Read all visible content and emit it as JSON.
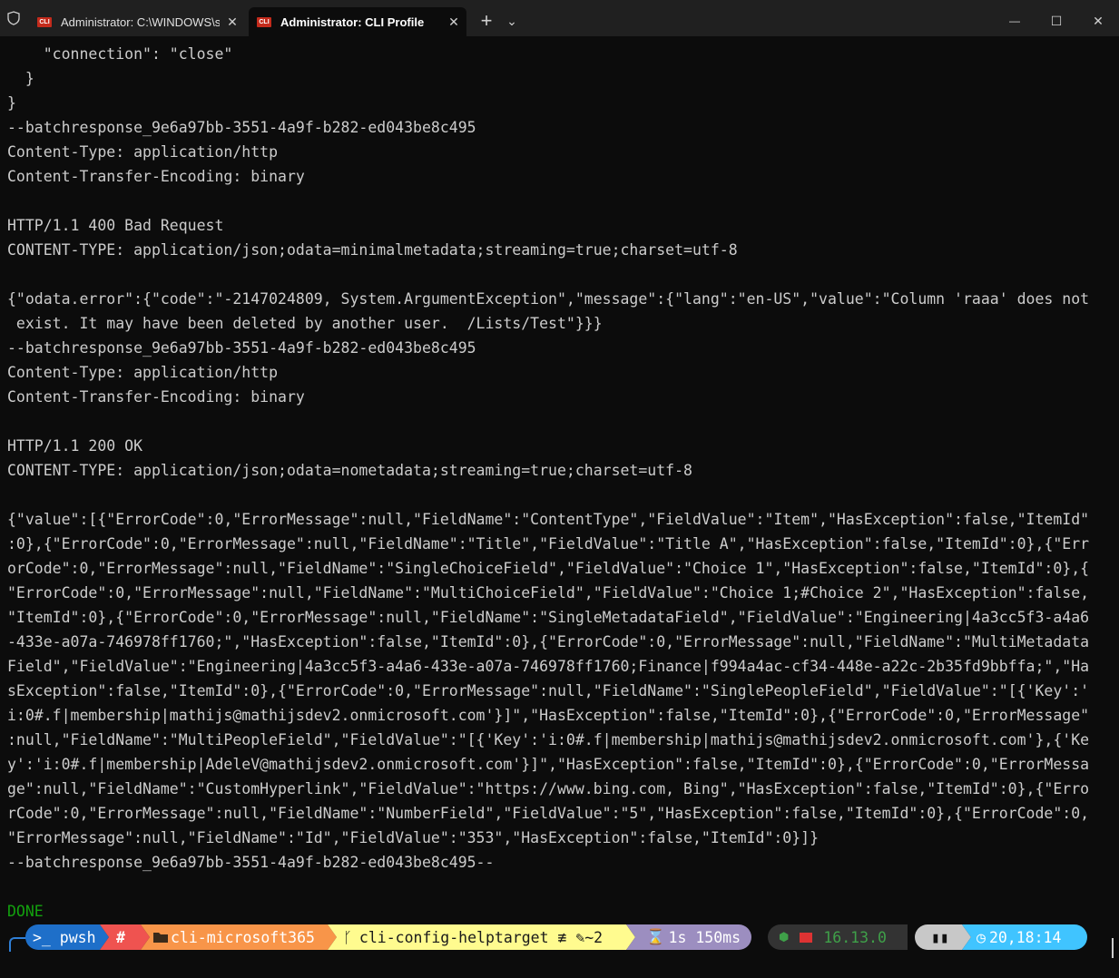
{
  "titlebar": {
    "tabs": [
      {
        "icon": "cli-icon",
        "icon_text": "CLI",
        "title": "Administrator: C:\\WINDOWS\\s"
      },
      {
        "icon": "cli-icon",
        "icon_text": "CLI",
        "title": "Administrator: CLI Profile"
      }
    ],
    "new_tab": "+",
    "dropdown": "⌄",
    "minimize": "—",
    "maximize": "☐",
    "close": "✕"
  },
  "terminal": {
    "lines": [
      "    \"connection\": \"close\"",
      "  }",
      "}",
      "--batchresponse_9e6a97bb-3551-4a9f-b282-ed043be8c495",
      "Content-Type: application/http",
      "Content-Transfer-Encoding: binary",
      "",
      "HTTP/1.1 400 Bad Request",
      "CONTENT-TYPE: application/json;odata=minimalmetadata;streaming=true;charset=utf-8",
      "",
      "{\"odata.error\":{\"code\":\"-2147024809, System.ArgumentException\",\"message\":{\"lang\":\"en-US\",\"value\":\"Column 'raaa' does not",
      " exist. It may have been deleted by another user.  /Lists/Test\"}}}",
      "--batchresponse_9e6a97bb-3551-4a9f-b282-ed043be8c495",
      "Content-Type: application/http",
      "Content-Transfer-Encoding: binary",
      "",
      "HTTP/1.1 200 OK",
      "CONTENT-TYPE: application/json;odata=nometadata;streaming=true;charset=utf-8",
      "",
      "{\"value\":[{\"ErrorCode\":0,\"ErrorMessage\":null,\"FieldName\":\"ContentType\",\"FieldValue\":\"Item\",\"HasException\":false,\"ItemId\"",
      ":0},{\"ErrorCode\":0,\"ErrorMessage\":null,\"FieldName\":\"Title\",\"FieldValue\":\"Title A\",\"HasException\":false,\"ItemId\":0},{\"Err",
      "orCode\":0,\"ErrorMessage\":null,\"FieldName\":\"SingleChoiceField\",\"FieldValue\":\"Choice 1\",\"HasException\":false,\"ItemId\":0},{",
      "\"ErrorCode\":0,\"ErrorMessage\":null,\"FieldName\":\"MultiChoiceField\",\"FieldValue\":\"Choice 1;#Choice 2\",\"HasException\":false,",
      "\"ItemId\":0},{\"ErrorCode\":0,\"ErrorMessage\":null,\"FieldName\":\"SingleMetadataField\",\"FieldValue\":\"Engineering|4a3cc5f3-a4a6",
      "-433e-a07a-746978ff1760;\",\"HasException\":false,\"ItemId\":0},{\"ErrorCode\":0,\"ErrorMessage\":null,\"FieldName\":\"MultiMetadata",
      "Field\",\"FieldValue\":\"Engineering|4a3cc5f3-a4a6-433e-a07a-746978ff1760;Finance|f994a4ac-cf34-448e-a22c-2b35fd9bbffa;\",\"Ha",
      "sException\":false,\"ItemId\":0},{\"ErrorCode\":0,\"ErrorMessage\":null,\"FieldName\":\"SinglePeopleField\",\"FieldValue\":\"[{'Key':'",
      "i:0#.f|membership|mathijs@mathijsdev2.onmicrosoft.com'}]\",\"HasException\":false,\"ItemId\":0},{\"ErrorCode\":0,\"ErrorMessage\"",
      ":null,\"FieldName\":\"MultiPeopleField\",\"FieldValue\":\"[{'Key':'i:0#.f|membership|mathijs@mathijsdev2.onmicrosoft.com'},{'Ke",
      "y':'i:0#.f|membership|AdeleV@mathijsdev2.onmicrosoft.com'}]\",\"HasException\":false,\"ItemId\":0},{\"ErrorCode\":0,\"ErrorMessa",
      "ge\":null,\"FieldName\":\"CustomHyperlink\",\"FieldValue\":\"https://www.bing.com, Bing\",\"HasException\":false,\"ItemId\":0},{\"Erro",
      "rCode\":0,\"ErrorMessage\":null,\"FieldName\":\"NumberField\",\"FieldValue\":\"5\",\"HasException\":false,\"ItemId\":0},{\"ErrorCode\":0,",
      "\"ErrorMessage\":null,\"FieldName\":\"Id\",\"FieldValue\":\"353\",\"HasException\":false,\"ItemId\":0}]}",
      "--batchresponse_9e6a97bb-3551-4a9f-b282-ed043be8c495--",
      ""
    ],
    "done_text": "DONE"
  },
  "prompt": {
    "shell": ">_ pwsh",
    "admin": "#",
    "folder": "cli-microsoft365",
    "git": "cli-config-helptarget ≢ ✎~2",
    "duration": "1s 150ms",
    "node_version": "16.13.0",
    "clock": "20,18:14",
    "colors": {
      "shell": "#1e6fc9",
      "admin": "#ef5350",
      "folder": "#f89549",
      "git": "#fffb8f",
      "duration": "#9c8ec0",
      "node": "#333333",
      "os": "#c8c8c8",
      "clock": "#40c4ff"
    }
  }
}
